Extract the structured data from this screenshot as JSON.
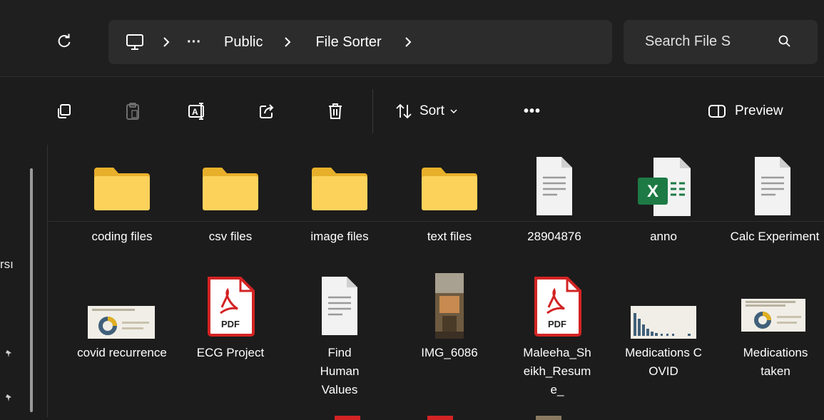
{
  "addressbar": {
    "overflow": "···",
    "crumbs": [
      "Public",
      "File Sorter"
    ]
  },
  "search": {
    "placeholder": "Search File S"
  },
  "toolbar": {
    "sort_label": "Sort",
    "more_label": "•••",
    "preview_label": "Preview"
  },
  "nav": {
    "fragment_text": "rsı"
  },
  "files": [
    {
      "name": "coding files",
      "type": "folder"
    },
    {
      "name": "csv files",
      "type": "folder"
    },
    {
      "name": "image files",
      "type": "folder"
    },
    {
      "name": "text files",
      "type": "folder"
    },
    {
      "name": "28904876",
      "type": "text-document"
    },
    {
      "name": "anno",
      "type": "excel-workbook"
    },
    {
      "name": "Calc Experiment",
      "type": "text-document"
    },
    {
      "name": "covid recurrence",
      "type": "image-thumbnail"
    },
    {
      "name": "ECG Project",
      "type": "pdf"
    },
    {
      "name": "Find Human Values",
      "type": "text-document"
    },
    {
      "name": "IMG_6086",
      "type": "photo"
    },
    {
      "name": "Maleeha_Sheikh_Resume_",
      "type": "pdf"
    },
    {
      "name": "Medications COVID",
      "type": "image-thumbnail"
    },
    {
      "name": "Medications taken",
      "type": "image-thumbnail"
    }
  ],
  "colors": {
    "background": "#1c1c1c",
    "bar": "#2c2c2c",
    "folder": "#f7c83c",
    "pdf_red": "#d32323",
    "excel_green": "#1d7a45"
  }
}
